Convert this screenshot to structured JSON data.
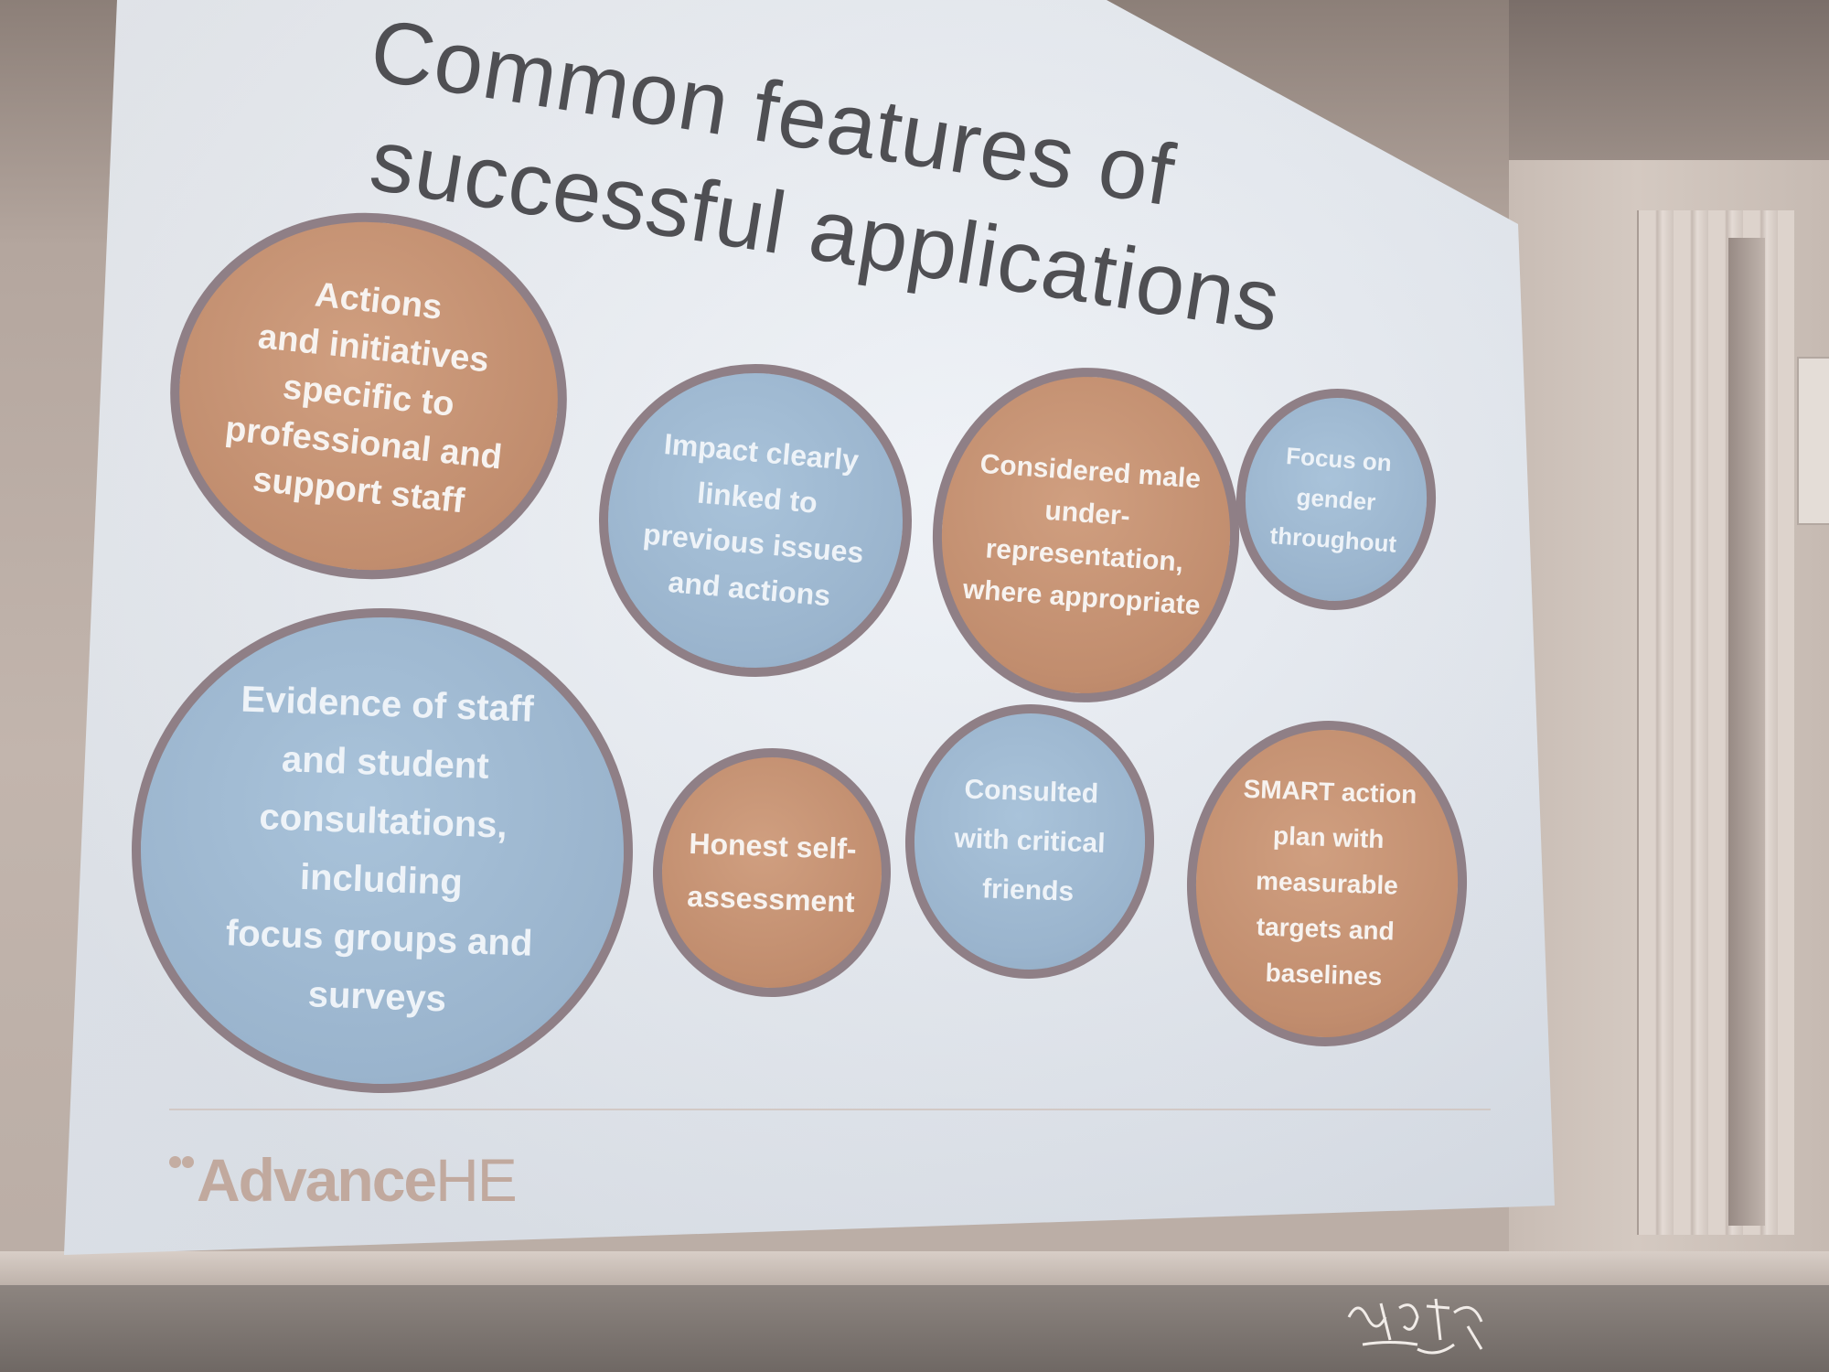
{
  "slide": {
    "title_line_1": "Common features of",
    "title_line_2": "successful applications"
  },
  "features": [
    {
      "text": "Actions\nand initiatives\nspecific to\nprofessional and\nsupport staff",
      "color": "#c18d6e"
    },
    {
      "text": "Impact clearly\nlinked to\nprevious issues\nand actions",
      "color": "#9ab4cd"
    },
    {
      "text": "Considered male\nunder-\nrepresentation,\nwhere appropriate",
      "color": "#c18d6e"
    },
    {
      "text": "Focus on\ngender\nthroughout",
      "color": "#9ab4cd"
    },
    {
      "text": "Evidence of staff\nand student\nconsultations,\nincluding\nfocus groups and\nsurveys",
      "color": "#9ab4cd"
    },
    {
      "text": "Honest self-\nassessment",
      "color": "#c18d6e"
    },
    {
      "text": "Consulted\nwith critical\nfriends",
      "color": "#9ab4cd"
    },
    {
      "text": "SMART action\nplan with\nmeasurable\ntargets and\nbaselines",
      "color": "#c18d6e"
    }
  ],
  "logo": {
    "word_bold": "Advance",
    "word_light": "HE"
  }
}
